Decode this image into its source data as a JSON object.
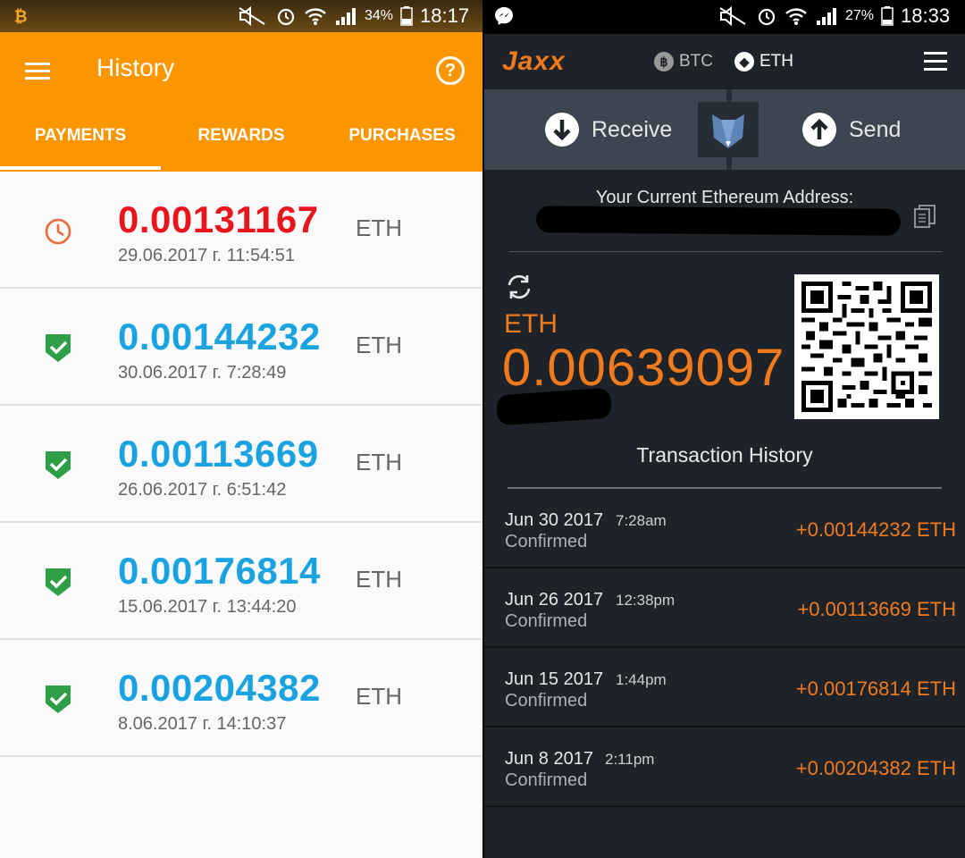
{
  "left": {
    "status": {
      "time": "18:17",
      "battery": "34%"
    },
    "appbar": {
      "title": "History"
    },
    "tabs": [
      {
        "label": "PAYMENTS",
        "active": true
      },
      {
        "label": "REWARDS",
        "active": false
      },
      {
        "label": "PURCHASES",
        "active": false
      }
    ],
    "payments": [
      {
        "amount": "0.00131167",
        "unit": "ETH",
        "date": "29.06.2017 г. 11:54:51",
        "status": "pending",
        "icon": "clock-icon"
      },
      {
        "amount": "0.00144232",
        "unit": "ETH",
        "date": "30.06.2017 г. 7:28:49",
        "status": "confirmed",
        "icon": "shield-check-icon"
      },
      {
        "amount": "0.00113669",
        "unit": "ETH",
        "date": "26.06.2017 г. 6:51:42",
        "status": "confirmed",
        "icon": "shield-check-icon"
      },
      {
        "amount": "0.00176814",
        "unit": "ETH",
        "date": "15.06.2017 г. 13:44:20",
        "status": "confirmed",
        "icon": "shield-check-icon"
      },
      {
        "amount": "0.00204382",
        "unit": "ETH",
        "date": "8.06.2017 г. 14:10:37",
        "status": "confirmed",
        "icon": "shield-check-icon"
      }
    ]
  },
  "right": {
    "status": {
      "time": "18:33",
      "battery": "27%"
    },
    "header": {
      "logo": "Jaxx",
      "coins": [
        {
          "label": "BTC",
          "symbol": "฿",
          "active": false
        },
        {
          "label": "ETH",
          "symbol": "◆",
          "active": true
        }
      ]
    },
    "actions": {
      "receive": "Receive",
      "send": "Send"
    },
    "address_label": "Your Current Ethereum Address:",
    "balance": {
      "unit": "ETH",
      "value": "0.00639097"
    },
    "tx_title": "Transaction History",
    "transactions": [
      {
        "date": "Jun 30 2017",
        "time": "7:28am",
        "status": "Confirmed",
        "amount": "+0.00144232 ETH"
      },
      {
        "date": "Jun 26 2017",
        "time": "12:38pm",
        "status": "Confirmed",
        "amount": "+0.00113669 ETH"
      },
      {
        "date": "Jun 15 2017",
        "time": "1:44pm",
        "status": "Confirmed",
        "amount": "+0.00176814 ETH"
      },
      {
        "date": "Jun 8 2017",
        "time": "2:11pm",
        "status": "Confirmed",
        "amount": "+0.00204382 ETH"
      }
    ]
  },
  "colors": {
    "appbar_orange": "#fb9601",
    "pending_red": "#e8161c",
    "confirmed_blue": "#1aa3e0",
    "check_green": "#2e9e47",
    "jaxx_orange": "#f07a1c",
    "jaxx_bg": "#1e2229"
  }
}
